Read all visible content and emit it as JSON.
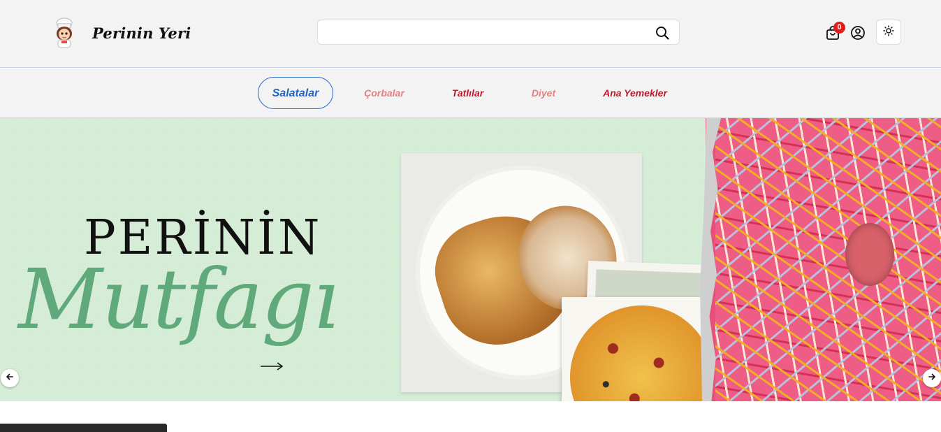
{
  "header": {
    "brand_name": "Perinin Yeri",
    "search": {
      "value": "",
      "placeholder": ""
    },
    "cart_count": "0",
    "icons": {
      "logo": "chef-girl-avatar-icon",
      "search": "search-icon",
      "cart": "shopping-bag-icon",
      "user": "user-circle-icon",
      "theme": "sun-icon"
    }
  },
  "nav": {
    "items": [
      {
        "label": "Salatalar",
        "active": true,
        "color": "#1f66c6"
      },
      {
        "label": "Çorbalar",
        "active": false,
        "color": "#e57f7f"
      },
      {
        "label": "Tatlılar",
        "active": false,
        "color": "#c0182a"
      },
      {
        "label": "Diyet",
        "active": false,
        "color": "#e57f7f"
      },
      {
        "label": "Ana Yemekler",
        "active": false,
        "color": "#c0182a"
      }
    ]
  },
  "hero": {
    "title": "PERİNİN",
    "script": "Mutfagı",
    "icons": {
      "prev": "chevron-left-icon",
      "next": "chevron-right-icon",
      "cta": "arrow-right-icon"
    }
  },
  "colors": {
    "accent": "#1f66c6",
    "badge": "#e21b1b",
    "hero_green": "#5fa97a"
  }
}
